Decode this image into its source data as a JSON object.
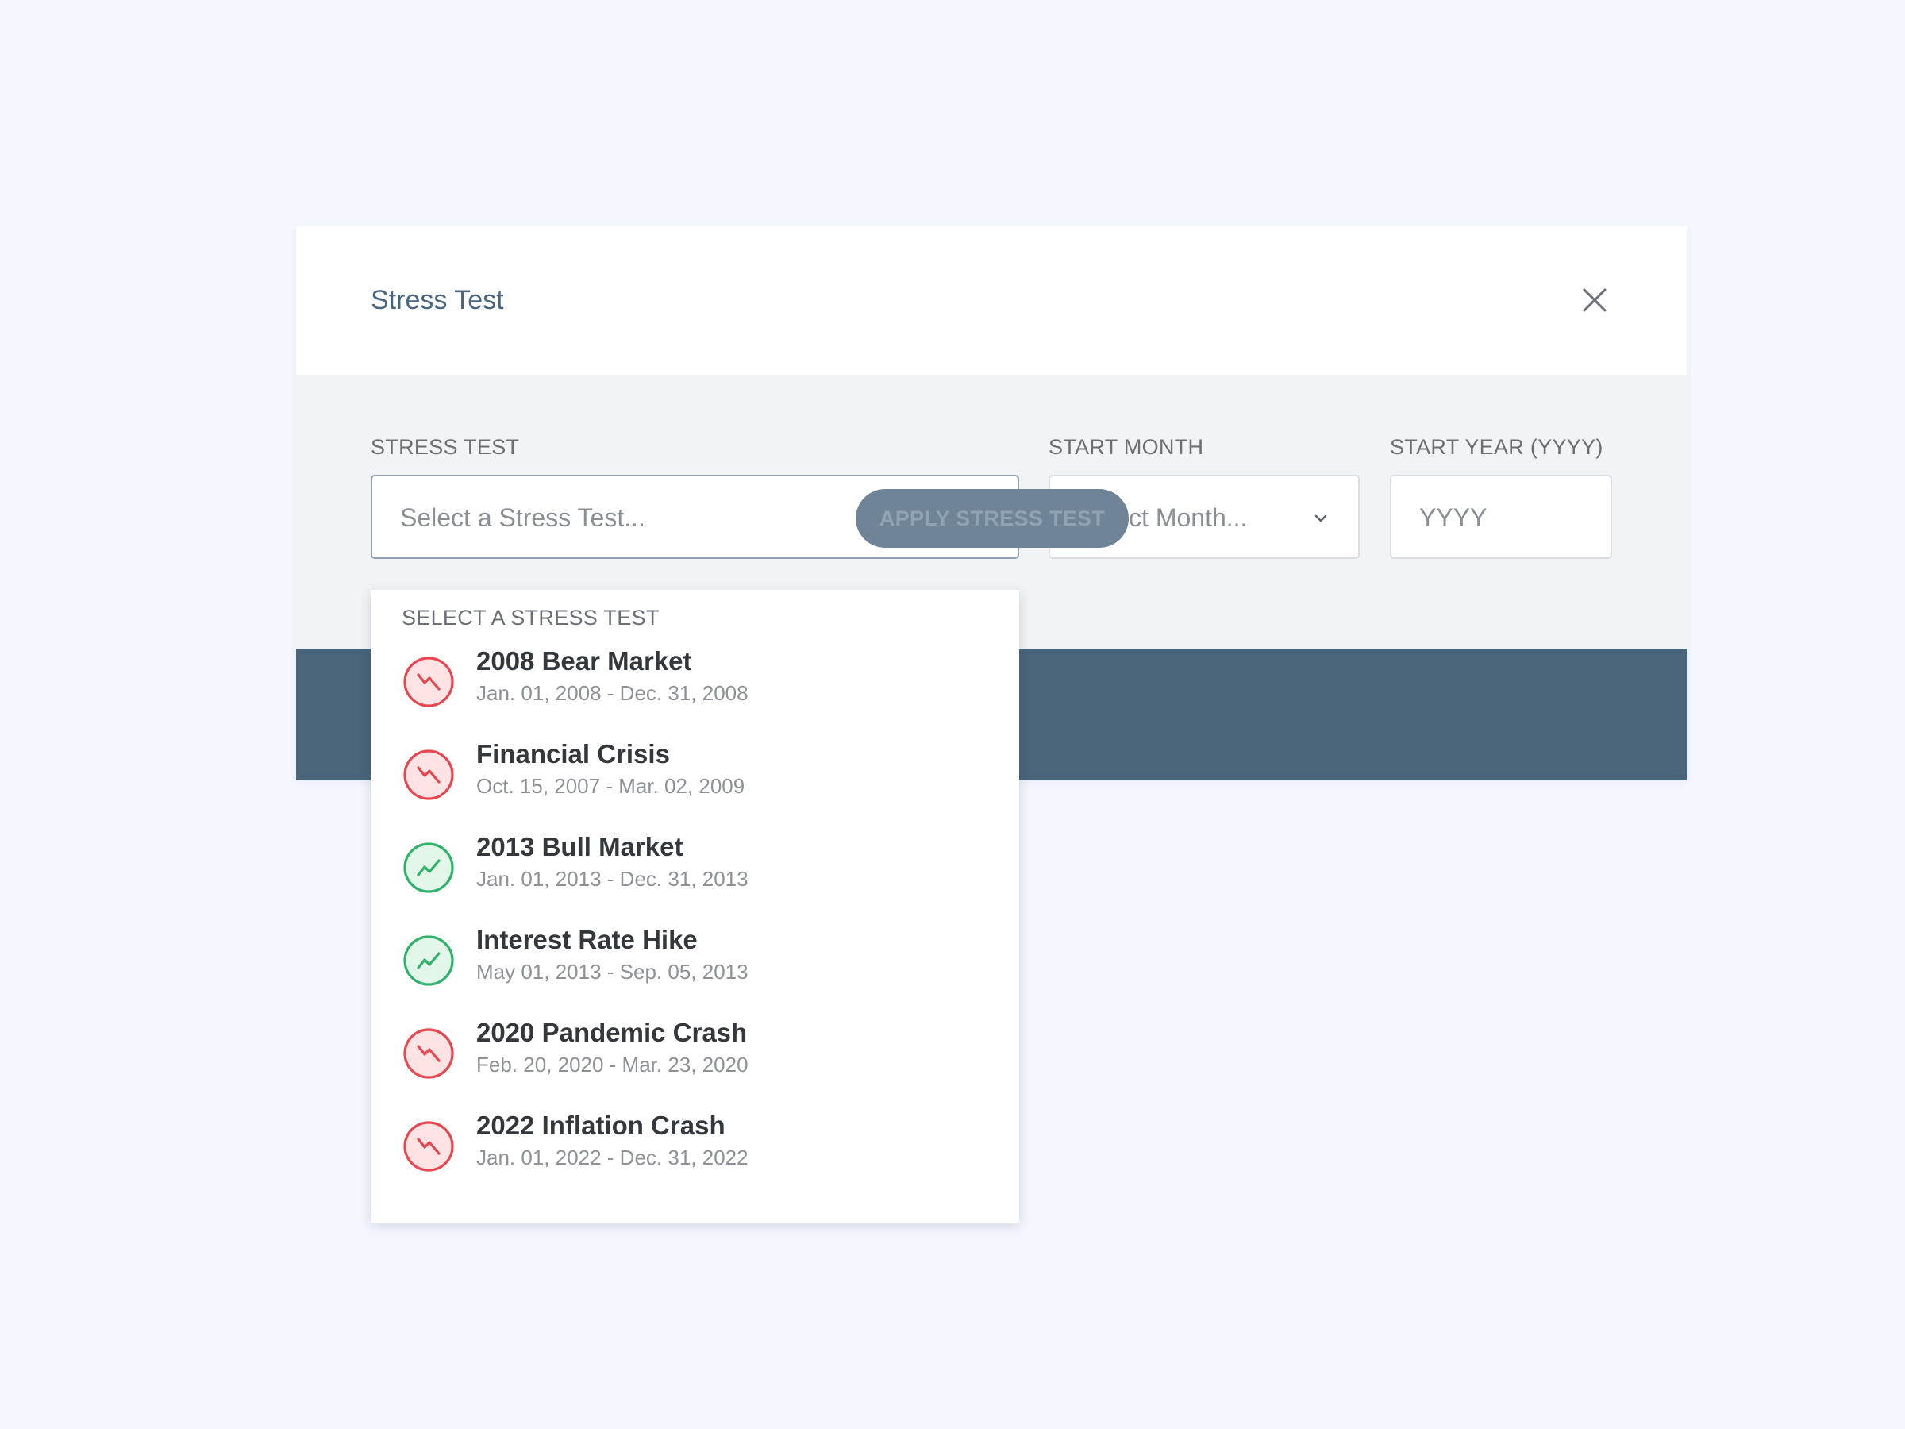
{
  "modal": {
    "title": "Stress Test"
  },
  "form": {
    "stress_test": {
      "label": "STRESS TEST",
      "placeholder": "Select a Stress Test..."
    },
    "start_month": {
      "label": "START MONTH",
      "placeholder": "Select Month..."
    },
    "start_year": {
      "label": "START YEAR (YYYY)",
      "placeholder": "YYYY"
    }
  },
  "footer": {
    "apply_label": "APPLY STRESS TEST"
  },
  "dropdown": {
    "header": "SELECT A STRESS TEST",
    "options": [
      {
        "title": "2008 Bear Market",
        "dates": "Jan. 01, 2008 - Dec. 31, 2008",
        "trend": "down"
      },
      {
        "title": "Financial Crisis",
        "dates": "Oct. 15, 2007 - Mar. 02, 2009",
        "trend": "down"
      },
      {
        "title": "2013 Bull Market",
        "dates": "Jan. 01, 2013 - Dec. 31, 2013",
        "trend": "up"
      },
      {
        "title": "Interest Rate Hike",
        "dates": "May 01, 2013 - Sep. 05, 2013",
        "trend": "up"
      },
      {
        "title": "2020 Pandemic Crash",
        "dates": "Feb. 20, 2020 - Mar. 23, 2020",
        "trend": "down"
      },
      {
        "title": "2022 Inflation Crash",
        "dates": "Jan. 01, 2022 - Dec. 31, 2022",
        "trend": "down"
      }
    ]
  },
  "colors": {
    "down": "#e8474f",
    "down_fill": "#fde3e4",
    "up": "#2fb36b",
    "up_fill": "#e3f6ea",
    "footer": "#4a6479",
    "title": "#4a6580"
  }
}
